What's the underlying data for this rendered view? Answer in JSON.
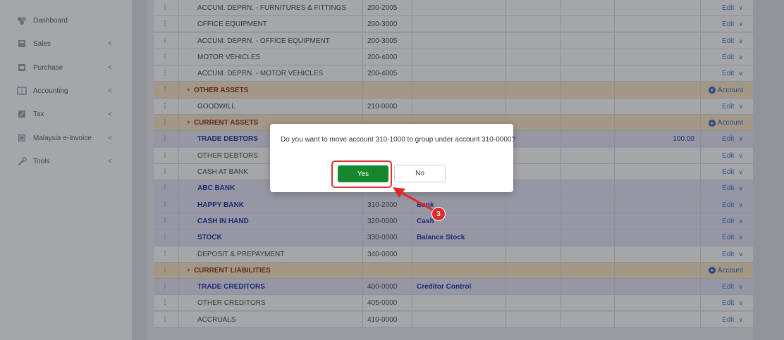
{
  "sidebar": {
    "items": [
      {
        "label": "Dashboard",
        "icon": "dashboard-icon",
        "expandable": false
      },
      {
        "label": "Sales",
        "icon": "sales-icon",
        "expandable": true
      },
      {
        "label": "Purchase",
        "icon": "purchase-icon",
        "expandable": true
      },
      {
        "label": "Accounting",
        "icon": "accounting-icon",
        "expandable": true
      },
      {
        "label": "Tax",
        "icon": "tax-icon",
        "expandable": true
      },
      {
        "label": "Malaysia e-Invoice",
        "icon": "einvoice-icon",
        "expandable": true
      },
      {
        "label": "Tools",
        "icon": "wrench-icon",
        "expandable": true
      }
    ],
    "chevron": "<"
  },
  "table": {
    "edit_label": "Edit",
    "add_account_label": "Account",
    "rows": [
      {
        "kind": "plain",
        "name": "ACCUM. DEPRN. - FURNITURES & FITTINGS",
        "code": "200-2005",
        "type": "",
        "amount": ""
      },
      {
        "kind": "plain",
        "name": "OFFICE EQUIPMENT",
        "code": "200-3000",
        "type": "",
        "amount": ""
      },
      {
        "kind": "plain",
        "name": "ACCUM. DEPRN. - OFFICE EQUIPMENT",
        "code": "200-3005",
        "type": "",
        "amount": ""
      },
      {
        "kind": "plain",
        "name": "MOTOR VEHICLES",
        "code": "200-4000",
        "type": "",
        "amount": ""
      },
      {
        "kind": "plain",
        "name": "ACCUM. DEPRN. - MOTOR VEHICLES",
        "code": "200-4005",
        "type": "",
        "amount": ""
      },
      {
        "kind": "group",
        "name": "OTHER ASSETS",
        "code": "",
        "type": "",
        "amount": ""
      },
      {
        "kind": "plain",
        "name": "GOODWILL",
        "code": "210-0000",
        "type": "",
        "amount": ""
      },
      {
        "kind": "group",
        "name": "CURRENT ASSETS",
        "code": "",
        "type": "",
        "amount": ""
      },
      {
        "kind": "hl",
        "name": "TRADE DEBTORS",
        "code": "",
        "type": "",
        "amount": "100.00"
      },
      {
        "kind": "plain",
        "name": "OTHER DEBTORS",
        "code": "",
        "type": "",
        "amount": ""
      },
      {
        "kind": "plain",
        "name": "CASH AT BANK",
        "code": "",
        "type": "",
        "amount": ""
      },
      {
        "kind": "hl",
        "name": "ABC BANK",
        "code": "",
        "type": "",
        "amount": ""
      },
      {
        "kind": "hl",
        "name": "HAPPY BANK",
        "code": "310-2000",
        "type": "Bank",
        "amount": ""
      },
      {
        "kind": "hl",
        "name": "CASH IN HAND",
        "code": "320-0000",
        "type": "Cash",
        "amount": ""
      },
      {
        "kind": "hl",
        "name": "STOCK",
        "code": "330-0000",
        "type": "Balance Stock",
        "amount": ""
      },
      {
        "kind": "plain",
        "name": "DEPOSIT & PREPAYMENT",
        "code": "340-0000",
        "type": "",
        "amount": ""
      },
      {
        "kind": "group",
        "name": "CURRENT LIABILITIES",
        "code": "",
        "type": "",
        "amount": ""
      },
      {
        "kind": "hl",
        "name": "TRADE CREDITORS",
        "code": "400-0000",
        "type": "Creditor Control",
        "amount": ""
      },
      {
        "kind": "plain",
        "name": "OTHER CREDITORS",
        "code": "405-0000",
        "type": "",
        "amount": ""
      },
      {
        "kind": "plain",
        "name": "ACCRUALS",
        "code": "410-0000",
        "type": "",
        "amount": ""
      }
    ]
  },
  "dialog": {
    "message": "Do you want to move account 310-1000 to group under account 310-0000?",
    "yes_label": "Yes",
    "no_label": "No"
  },
  "annotation": {
    "step": "3"
  },
  "colors": {
    "group_row": "#fbe6bf",
    "highlight_row": "#e4e6f6",
    "yes_button": "#15872f",
    "annotation": "#e02a2a"
  }
}
